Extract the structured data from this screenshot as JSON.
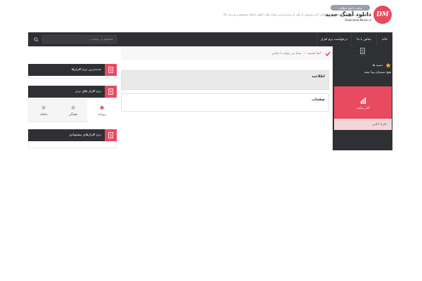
{
  "header": {
    "logo_letters": "DM",
    "badge": "سایت دانلود مطالب",
    "title": "دانلود آهنگ جدید",
    "domain": "Download-Music.in",
    "description": "دانلود دانلود نرم افزار، فیلم، سیستم عامل، آنتی ویروس از یکی از پربازدیدترین سایت های دانلود با لینک مستقیم و سرعت بالا"
  },
  "nav": {
    "items": [
      {
        "label": "خانه"
      },
      {
        "label": "تماس با ما"
      },
      {
        "label": "درخواست نرم افزار"
      }
    ],
    "search_placeholder": "جستجو در سایت..."
  },
  "right_sidebar": {
    "category_label": "دسته ها",
    "no_categories": "هیچ دسته‌ای پیدا نشد",
    "stats_label": "آمار سایت",
    "stats_sub": "افراد آنلاین :"
  },
  "breadcrumb": {
    "current": "آنجا هستید :",
    "separator": "»",
    "home": "شما می توانید با تماس"
  },
  "main": {
    "announcement_title": "اطلاعیه",
    "pages_title": "صفحات"
  },
  "widgets": {
    "newest_title": "جدیدترین نرم افزارها",
    "top_title": "نرم افزار های برتر",
    "tabs": [
      {
        "label": "روزانه"
      },
      {
        "label": "هفتگی"
      },
      {
        "label": "ماهانه"
      }
    ],
    "suggested_title": "نرم افزارهای پیشنهادی"
  },
  "colors": {
    "accent": "#e84a5f",
    "dark": "#2f3033"
  }
}
